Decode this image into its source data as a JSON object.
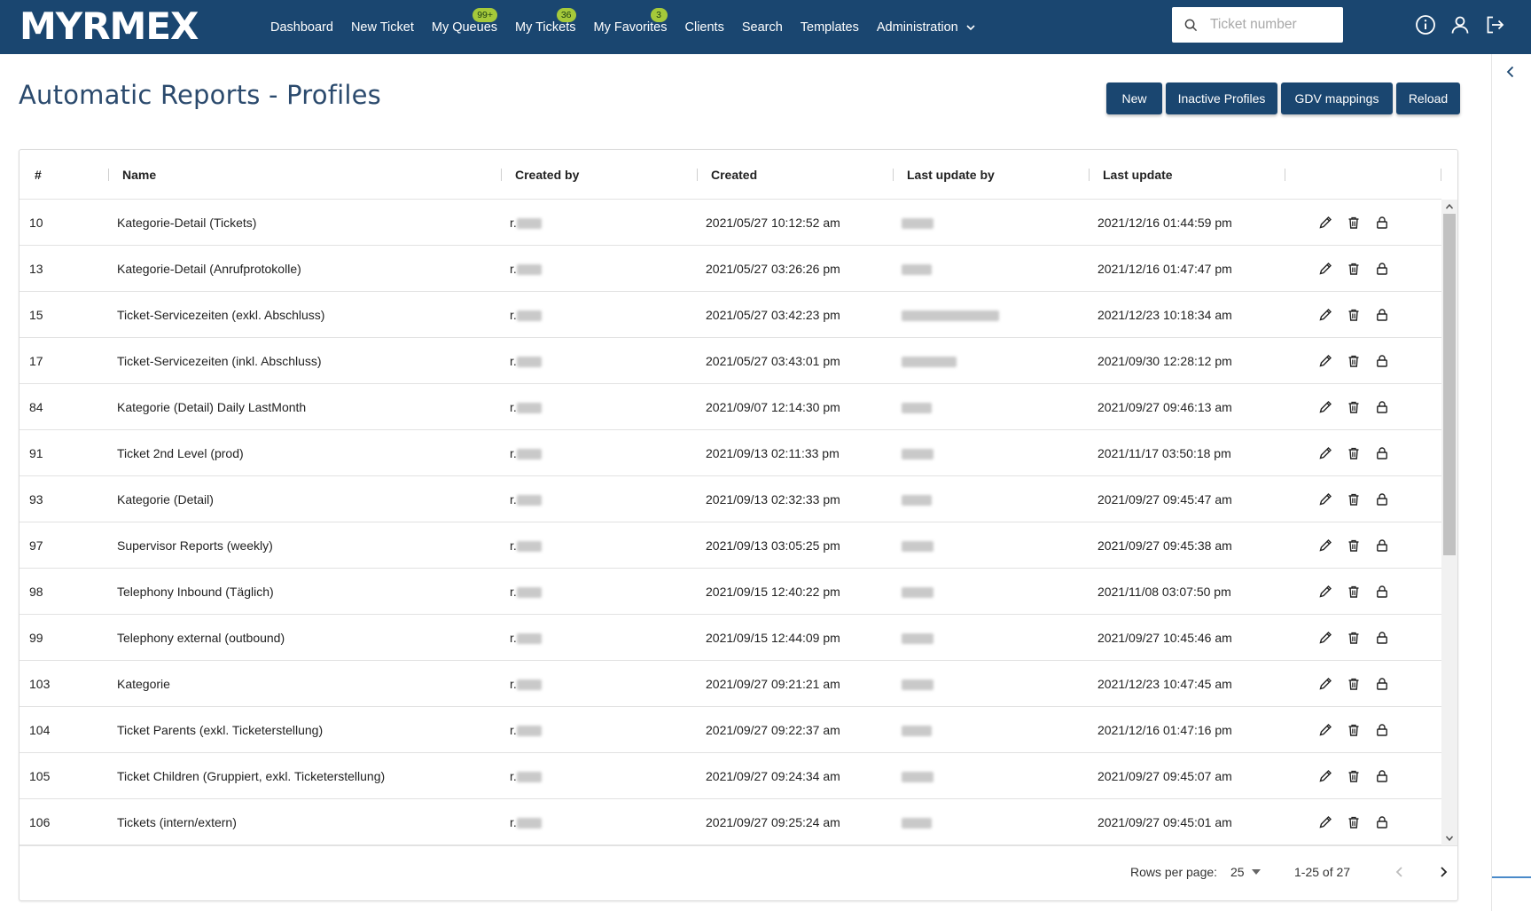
{
  "app": {
    "logo": "MYRMEX"
  },
  "nav": [
    {
      "label": "Dashboard",
      "badge": null
    },
    {
      "label": "New Ticket",
      "badge": null
    },
    {
      "label": "My Queues",
      "badge": "99+"
    },
    {
      "label": "My Tickets",
      "badge": "36"
    },
    {
      "label": "My Favorites",
      "badge": "3"
    },
    {
      "label": "Clients",
      "badge": null
    },
    {
      "label": "Search",
      "badge": null
    },
    {
      "label": "Templates",
      "badge": null
    },
    {
      "label": "Administration",
      "badge": null
    }
  ],
  "search": {
    "placeholder": "Ticket number",
    "value": ""
  },
  "page": {
    "title": "Automatic Reports - Profiles"
  },
  "actions": {
    "new": "New",
    "inactive": "Inactive Profiles",
    "gdv": "GDV mappings",
    "reload": "Reload"
  },
  "table": {
    "columns": [
      "#",
      "Name",
      "Created by",
      "Created",
      "Last update by",
      "Last update"
    ],
    "rows": [
      {
        "id": "10",
        "name": "Kategorie-Detail (Tickets)",
        "created_by": "r.",
        "created": "2021/05/27 10:12:52 am",
        "updated_by": "",
        "updated": "2021/12/16 01:44:59 pm"
      },
      {
        "id": "13",
        "name": "Kategorie-Detail (Anrufprotokolle)",
        "created_by": "r.",
        "created": "2021/05/27 03:26:26 pm",
        "updated_by": "",
        "updated": "2021/12/16 01:47:47 pm"
      },
      {
        "id": "15",
        "name": "Ticket-Servicezeiten (exkl. Abschluss)",
        "created_by": "r.",
        "created": "2021/05/27 03:42:23 pm",
        "updated_by": "",
        "updated": "2021/12/23 10:18:34 am"
      },
      {
        "id": "17",
        "name": "Ticket-Servicezeiten (inkl. Abschluss)",
        "created_by": "r.",
        "created": "2021/05/27 03:43:01 pm",
        "updated_by": "",
        "updated": "2021/09/30 12:28:12 pm"
      },
      {
        "id": "84",
        "name": "Kategorie (Detail) Daily LastMonth",
        "created_by": "r.",
        "created": "2021/09/07 12:14:30 pm",
        "updated_by": "",
        "updated": "2021/09/27 09:46:13 am"
      },
      {
        "id": "91",
        "name": "Ticket 2nd Level (prod)",
        "created_by": "r.",
        "created": "2021/09/13 02:11:33 pm",
        "updated_by": "",
        "updated": "2021/11/17 03:50:18 pm"
      },
      {
        "id": "93",
        "name": "Kategorie (Detail)",
        "created_by": "r.",
        "created": "2021/09/13 02:32:33 pm",
        "updated_by": "",
        "updated": "2021/09/27 09:45:47 am"
      },
      {
        "id": "97",
        "name": "Supervisor Reports (weekly)",
        "created_by": "r.",
        "created": "2021/09/13 03:05:25 pm",
        "updated_by": "",
        "updated": "2021/09/27 09:45:38 am"
      },
      {
        "id": "98",
        "name": "Telephony Inbound (Täglich)",
        "created_by": "r.",
        "created": "2021/09/15 12:40:22 pm",
        "updated_by": "",
        "updated": "2021/11/08 03:07:50 pm"
      },
      {
        "id": "99",
        "name": "Telephony external (outbound)",
        "created_by": "r.",
        "created": "2021/09/15 12:44:09 pm",
        "updated_by": "",
        "updated": "2021/09/27 10:45:46 am"
      },
      {
        "id": "103",
        "name": "Kategorie",
        "created_by": "r.",
        "created": "2021/09/27 09:21:21 am",
        "updated_by": "",
        "updated": "2021/12/23 10:47:45 am"
      },
      {
        "id": "104",
        "name": "Ticket Parents (exkl. Ticketerstellung)",
        "created_by": "r.",
        "created": "2021/09/27 09:22:37 am",
        "updated_by": "",
        "updated": "2021/12/16 01:47:16 pm"
      },
      {
        "id": "105",
        "name": "Ticket Children (Gruppiert, exkl. Ticketerstellung)",
        "created_by": "r.",
        "created": "2021/09/27 09:24:34 am",
        "updated_by": "",
        "updated": "2021/09/27 09:45:07 am"
      },
      {
        "id": "106",
        "name": "Tickets (intern/extern)",
        "created_by": "r.",
        "created": "2021/09/27 09:25:24 am",
        "updated_by": "",
        "updated": "2021/09/27 09:45:01 am"
      }
    ]
  },
  "pagination": {
    "rows_label": "Rows per page:",
    "rows_value": "25",
    "range": "1-25 of 27"
  },
  "icons": {
    "row_actions": [
      "pencil-icon",
      "trash-icon",
      "lock-icon"
    ],
    "topbar": [
      "info-icon",
      "user-icon",
      "logout-icon"
    ]
  },
  "colors": {
    "brand": "#1a4670",
    "badge": "#a5c93a",
    "title": "#2b4a6d"
  }
}
